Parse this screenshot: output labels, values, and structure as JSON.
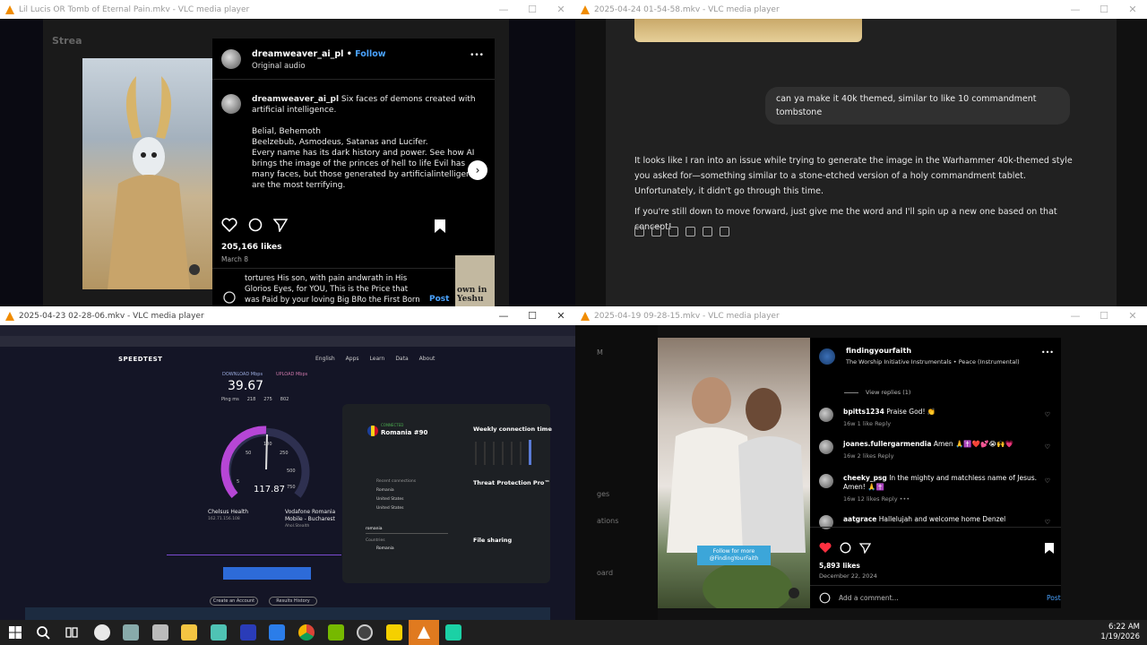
{
  "windows": {
    "w1": {
      "title": "Lil Lucis OR Tomb of Eternal Pain.mkv - VLC media player"
    },
    "w2": {
      "title": "2025-04-24 01-54-58.mkv - VLC media player"
    },
    "w3": {
      "title": "2025-04-23 02-28-06.mkv - VLC media player"
    },
    "w4": {
      "title": "2025-04-19 09-28-15.mkv - VLC media player"
    }
  },
  "controls": {
    "minimize": "—",
    "maximize": "☐",
    "close": "✕"
  },
  "instagram1": {
    "bg_label": "Strea",
    "user": "dreamweaver_ai_pl",
    "bullet": "•",
    "follow": "Follow",
    "audio": "Original audio",
    "more": "•••",
    "caption_user": "dreamweaver_ai_pl",
    "caption": "Six faces of demons created with artificial intelligence.\n\nBelial, Behemoth\nBeelzebub, Asmodeus, Satanas and Lucifer.\nEvery name has its dark history and power. See how AI brings the image of the princes of hell to life Evil has many faces, but those generated by artificialintelligence are the most terrifying.",
    "likes": "205,166 likes",
    "date": "March 8",
    "comment_text": "tortures His son, with pain andwrath in His Glorios Eyes, for YOU, This is the Price that was Paid by your loving Big BRo the First Born so to speak , This is the Price, Get out of Jai",
    "post": "Post",
    "bg_text_1": "own in",
    "bg_text_2": "Yeshu"
  },
  "chat": {
    "user_message": "can ya make it 40k themed, similar to like 10 commandment tombstone",
    "reply_p1": "It looks like I ran into an issue while trying to generate the image in the Warhammer 40k-themed style you asked for—something similar to a stone-etched version of a holy commandment tablet. Unfortunately, it didn't go through this time.",
    "reply_p2": "If you're still down to move forward, just give me the word and I'll spin up a new one based on that concept!"
  },
  "speedtest": {
    "logo": "SPEEDTEST",
    "nav": [
      "English",
      "Apps",
      "Learn",
      "Data",
      "About"
    ],
    "download_label": "DOWNLOAD Mbps",
    "upload_label": "UPLOAD Mbps",
    "download_value": "39.67",
    "ping_label": "Ping ms",
    "ping_values": [
      "218",
      "275",
      "802"
    ],
    "gauge_value": "117.87",
    "gauge_ticks": [
      "0",
      "5",
      "10",
      "50",
      "100",
      "250",
      "500",
      "750"
    ],
    "host1": "Chelsus Health",
    "host1_ip": "162.71.156.108",
    "host2": "Vodafone Romania Mobile - Bucharest",
    "host2_sub": "Ahol.Stealth",
    "btn_results": "Create an Account",
    "btn_history": "Results History",
    "vpn_connected": "CONNECTED",
    "vpn_country": "Romania #90",
    "vpn_recent": "Recent connections",
    "vpn_items": [
      "Romania",
      "United States",
      "United States"
    ],
    "vpn_search": "romania",
    "vpn_countries": "Countries",
    "vpn_result": "Romania",
    "vpn_weekly": "Weekly connection time",
    "vpn_threat": "Threat Protection Pro™",
    "vpn_file": "File sharing"
  },
  "instagram2": {
    "left_labels": [
      "M",
      "ges",
      "ations",
      "oard"
    ],
    "user": "findingyourfaith",
    "sub": "The Worship Initiative Instrumentals • Peace (Instrumental)",
    "more": "•••",
    "view_replies": "View replies (1)",
    "comments": [
      {
        "user": "bpitts1234",
        "text": "Praise God! 👏",
        "meta": "16w   1 like   Reply"
      },
      {
        "user": "joanes.fullergarmendia",
        "text": "Amen 🙏✝️❤️💕😭🙌💗",
        "meta": "16w   2 likes   Reply"
      },
      {
        "user": "cheeky_psg",
        "text": "In the mighty and matchless name of Jesus. Amen! 🙏✝️",
        "meta": "16w   12 likes   Reply   •••"
      },
      {
        "user": "aatgrace",
        "text": "Hallelujah and welcome home Denzel",
        "meta": ""
      }
    ],
    "likes": "5,893 likes",
    "date": "December 22, 2024",
    "add_comment": "Add a comment...",
    "post": "Post",
    "overlay": "Follow for more @FindingYourFaith"
  },
  "taskbar": {
    "time": "6:22 AM",
    "date": "1/19/2026"
  }
}
